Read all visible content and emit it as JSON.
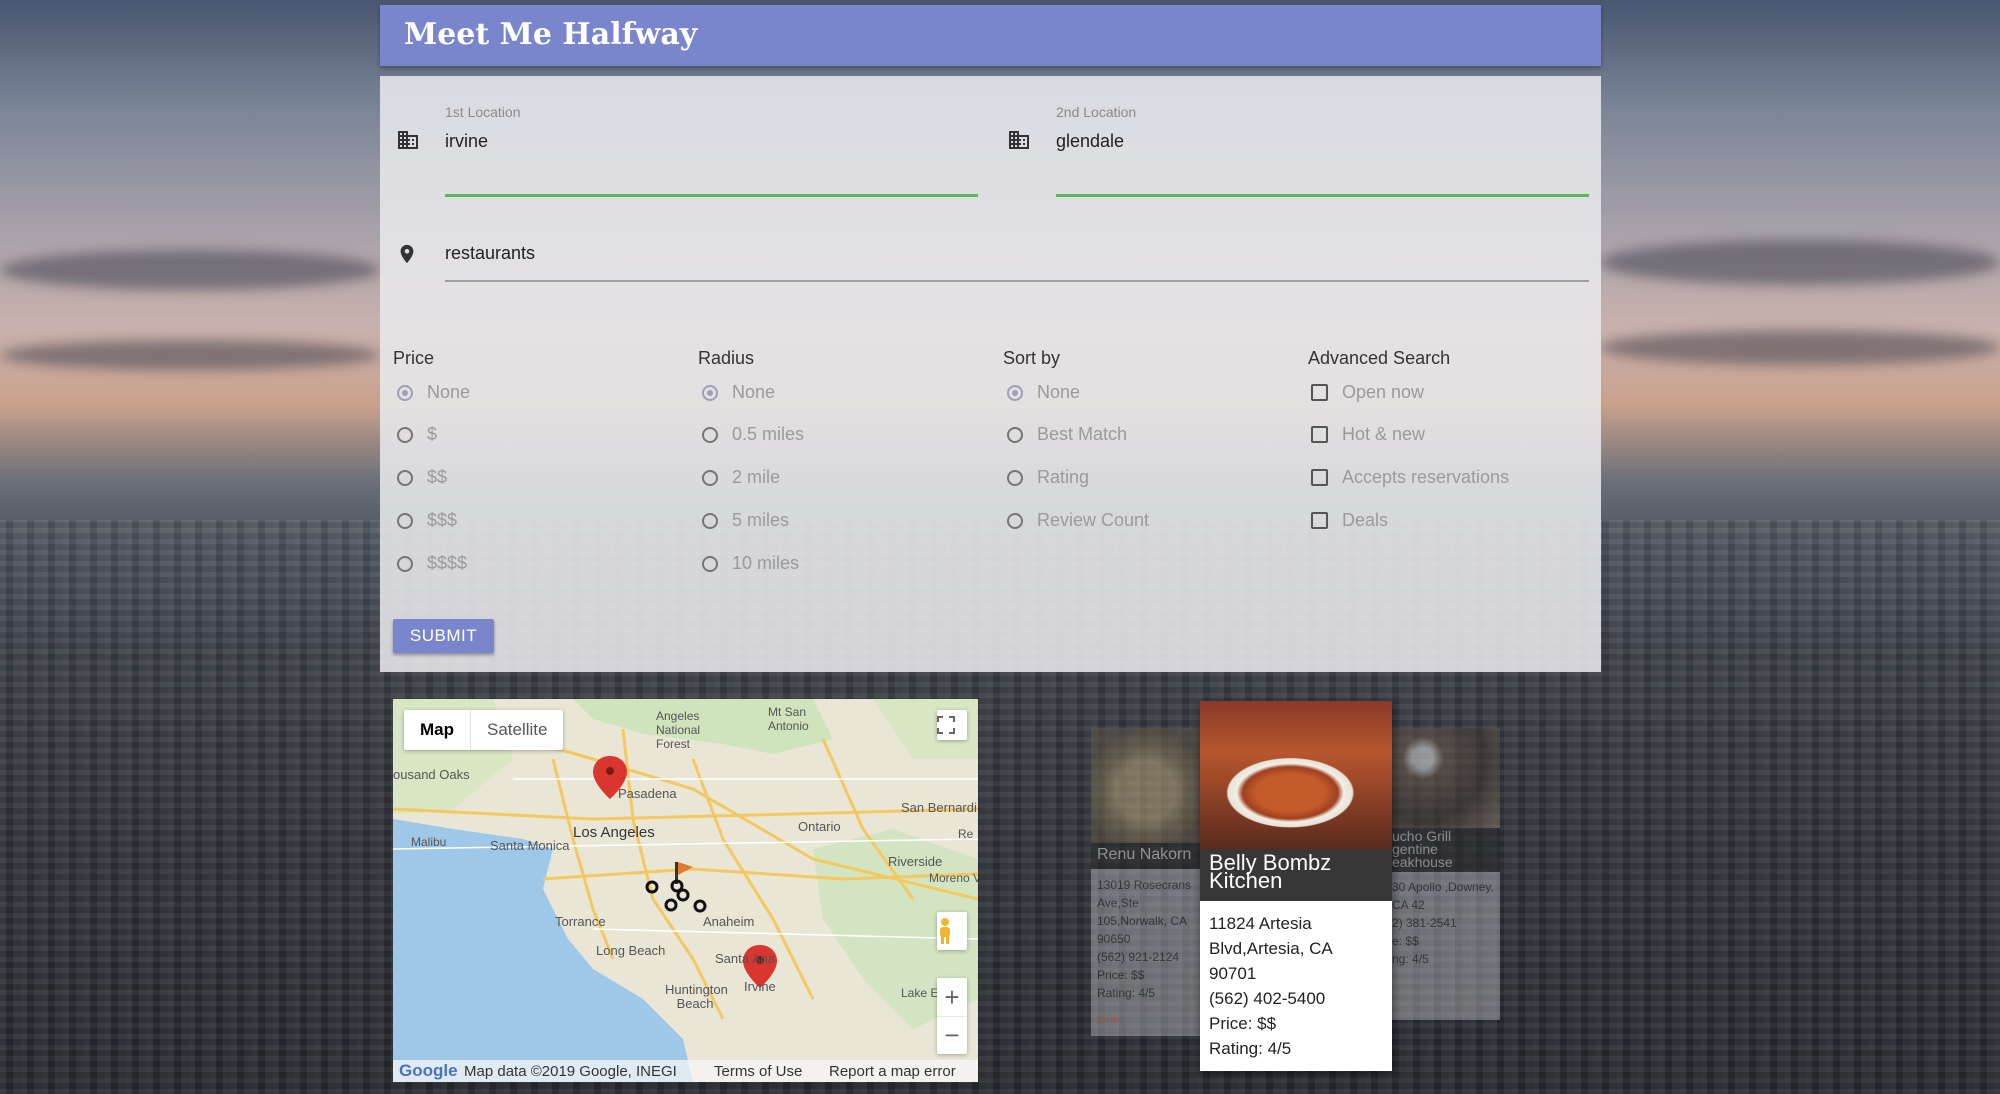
{
  "app": {
    "title": "Meet Me Halfway"
  },
  "form": {
    "location1": {
      "label": "1st Location",
      "value": "irvine"
    },
    "location2": {
      "label": "2nd Location",
      "value": "glendale"
    },
    "term": {
      "value": "restaurants"
    },
    "price": {
      "title": "Price",
      "options": [
        "None",
        "$",
        "$$",
        "$$$",
        "$$$$"
      ],
      "selected": "None"
    },
    "radius": {
      "title": "Radius",
      "options": [
        "None",
        "0.5 miles",
        "2 mile",
        "5 miles",
        "10 miles"
      ],
      "selected": "None"
    },
    "sort": {
      "title": "Sort by",
      "options": [
        "None",
        "Best Match",
        "Rating",
        "Review Count"
      ],
      "selected": "None"
    },
    "advanced": {
      "title": "Advanced Search",
      "options": [
        "Open now",
        "Hot & new",
        "Accepts reservations",
        "Deals"
      ]
    },
    "submit_label": "SUBMIT"
  },
  "map": {
    "type_map": "Map",
    "type_satellite": "Satellite",
    "labels": {
      "angeles_forest": "Angeles National Forest",
      "mt_san_antonio": "Mt San Antonio",
      "thousand_oaks": "ousand Oaks",
      "pasadena": "Pasadena",
      "san_bernardino": "San Bernardi",
      "los_angeles": "Los Angeles",
      "ontario": "Ontario",
      "malibu": "Malibu",
      "santa_monica": "Santa Monica",
      "riverside": "Riverside",
      "moreno": "Moreno V",
      "torrance": "Torrance",
      "anaheim": "Anaheim",
      "long_beach": "Long Beach",
      "santa_ana": "Santa Ana",
      "irvine": "Irvine",
      "huntington": "Huntington Beach",
      "lake": "Lake E",
      "r": "Re"
    },
    "google": "Google",
    "attribution": "Map data ©2019 Google, INEGI",
    "terms": "Terms of Use",
    "report": "Report a map error",
    "zoom_in": "+",
    "zoom_out": "−"
  },
  "cards": {
    "left": {
      "name": "Renu Nakorn",
      "address": "13019 Rosecrans Ave,Ste 105,Norwalk, CA 90650",
      "phone": "(562) 921-2124",
      "price": "Price: $$",
      "rating": "Rating: 4/5",
      "link": "Link"
    },
    "center": {
      "name": "Belly Bombz Kitchen",
      "address": "11824 Artesia Blvd,Artesia, CA 90701",
      "phone": "(562) 402-5400",
      "price": "Price: $$",
      "rating": "Rating: 4/5"
    },
    "right": {
      "name": "ucho Grill gentine eakhouse",
      "address": "30 Apollo ,Downey, CA 42",
      "phone": "2) 381-2541",
      "price": "e: $$",
      "rating": "ng: 4/5"
    }
  },
  "colors": {
    "header": "#7986cb",
    "focus_underline": "#5cb85c",
    "marker": "#d9362f"
  }
}
